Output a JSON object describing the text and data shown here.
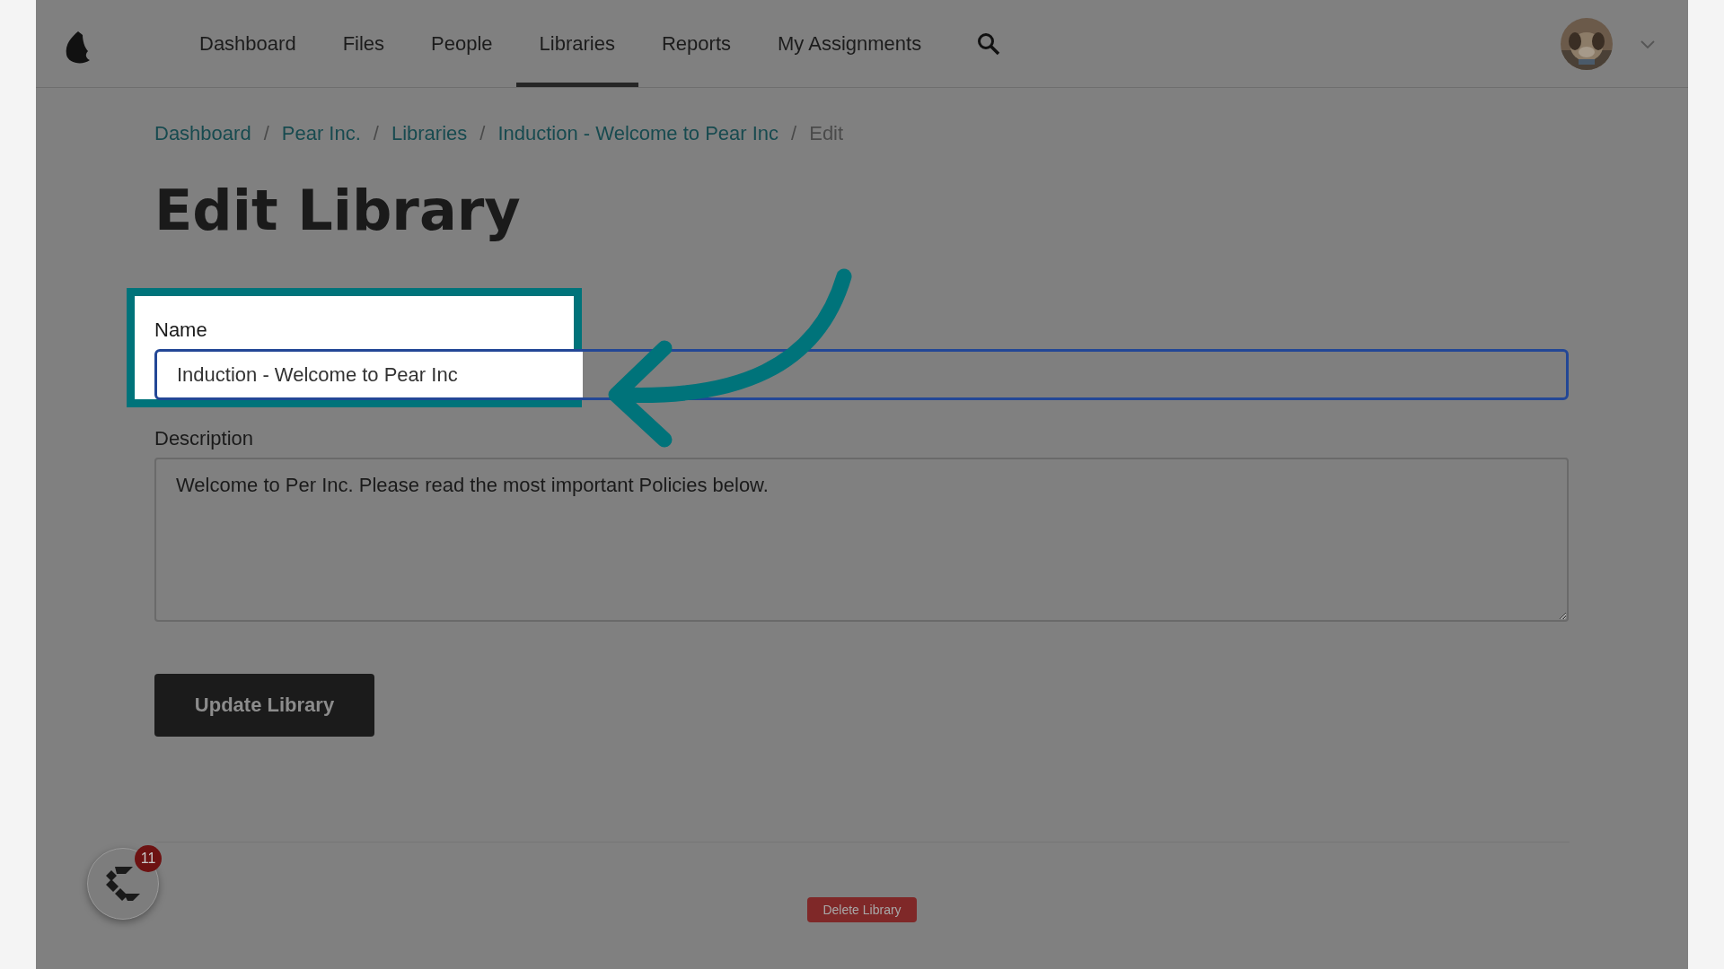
{
  "nav": {
    "items": [
      {
        "label": "Dashboard",
        "selected": false
      },
      {
        "label": "Files",
        "selected": false
      },
      {
        "label": "People",
        "selected": false
      },
      {
        "label": "Libraries",
        "selected": true
      },
      {
        "label": "Reports",
        "selected": false
      },
      {
        "label": "My Assignments",
        "selected": false
      }
    ]
  },
  "breadcrumb": [
    {
      "label": "Dashboard",
      "current": false
    },
    {
      "label": "Pear Inc.",
      "current": false
    },
    {
      "label": "Libraries",
      "current": false
    },
    {
      "label": "Induction - Welcome to Pear Inc",
      "current": false
    },
    {
      "label": "Edit",
      "current": true
    }
  ],
  "breadcrumb_separator": "/",
  "title": "Edit Library",
  "name_field": {
    "label": "Name",
    "value": "Induction - Welcome to Pear Inc"
  },
  "description_field": {
    "label": "Description",
    "value": "Welcome to Per Inc. Please read the most important Policies below."
  },
  "submit_button": "Update Library",
  "delete_button": "Delete Library",
  "chat_widget": {
    "badge": "11"
  }
}
